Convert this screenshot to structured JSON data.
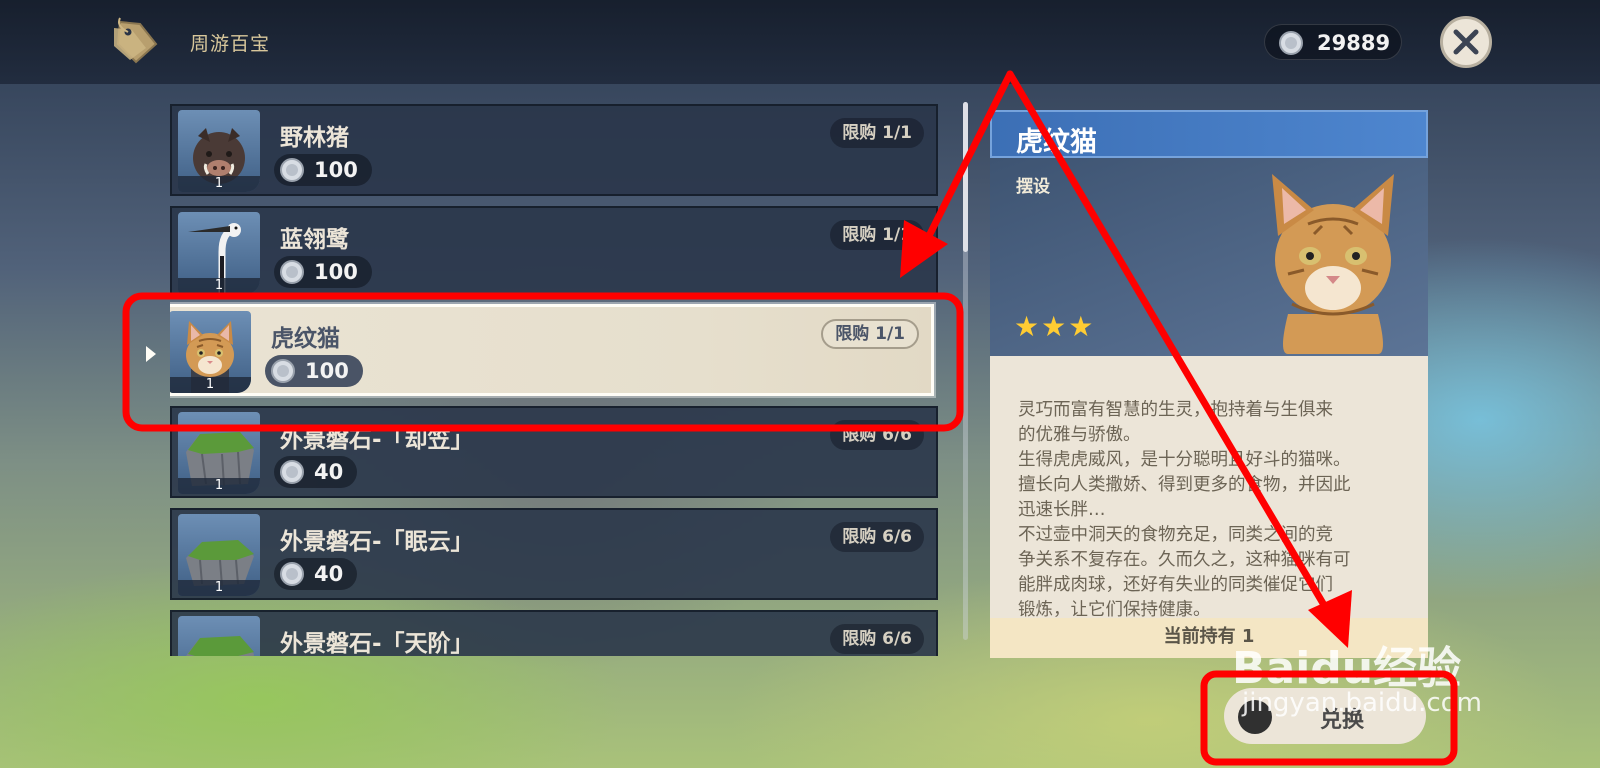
{
  "header": {
    "title": "周游百宝",
    "currency_amount": "29889"
  },
  "items": [
    {
      "name": "野林猪",
      "price": "100",
      "limit": "限购 1/1",
      "qty": "1",
      "icon": "boar-icon"
    },
    {
      "name": "蓝翎鹭",
      "price": "100",
      "limit": "限购 1/1",
      "qty": "1",
      "icon": "heron-icon"
    },
    {
      "name": "虎纹猫",
      "price": "100",
      "limit": "限购 1/1",
      "qty": "1",
      "icon": "cat-icon",
      "selected": true
    },
    {
      "name": "外景磐石-「却笠」",
      "price": "40",
      "limit": "限购 6/6",
      "qty": "1",
      "icon": "rock-icon"
    },
    {
      "name": "外景磐石-「眠云」",
      "price": "40",
      "limit": "限购 6/6",
      "qty": "1",
      "icon": "rock-icon"
    },
    {
      "name": "外景磐石-「天阶」",
      "price": "",
      "limit": "限购 6/6",
      "qty": "",
      "icon": "rock-icon"
    }
  ],
  "detail": {
    "title": "虎纹猫",
    "type": "摆设",
    "stars": "★★★",
    "rarity": 3,
    "description": [
      "灵巧而富有智慧的生灵，抱持着与生俱来",
      "的优雅与骄傲。",
      "生得虎虎威风，是十分聪明且好斗的猫咪。",
      "擅长向人类撒娇、得到更多的食物，并因此",
      "迅速长胖…",
      "不过壶中洞天的食物充足，同类之间的竞",
      "争关系不复存在。久而久之，这种猫咪有可",
      "能胖成肉球，还好有失业的同类催促它们",
      "锻炼，让它们保持健康。"
    ],
    "held": "当前持有 1"
  },
  "buy_button": {
    "label": "兑换"
  },
  "watermark": {
    "text": "Baidu经验",
    "sub": "jingyan.baidu.com"
  },
  "colors": {
    "annotation": "#ff0000",
    "selected_bg": "#eae3d3",
    "header_blue": "#4e86cf",
    "star": "#ffcc33"
  }
}
